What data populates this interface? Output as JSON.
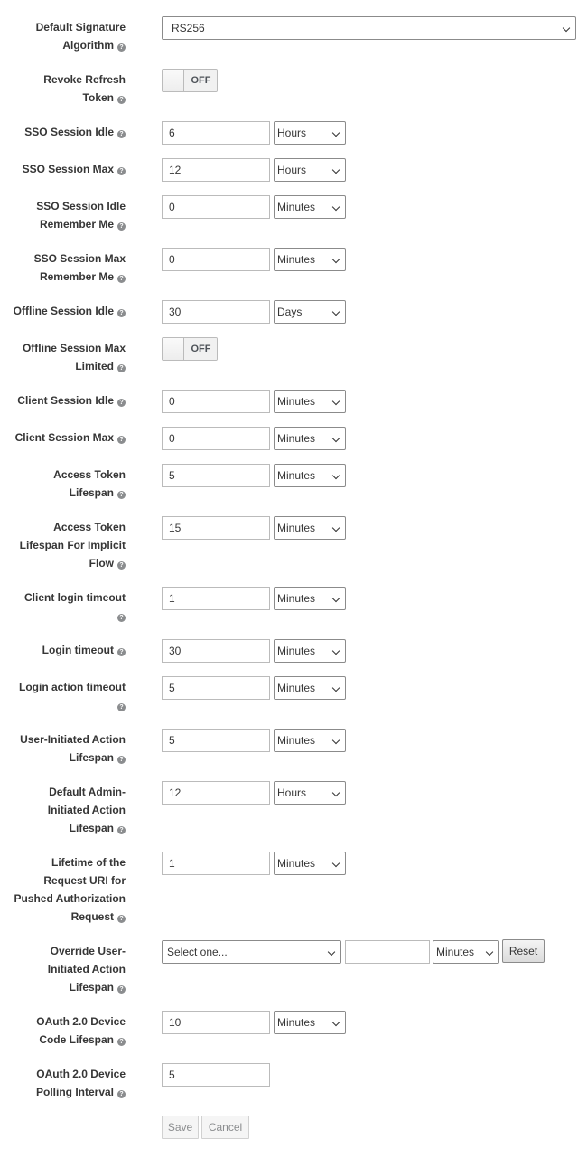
{
  "fields": {
    "default_signature_algorithm": {
      "label": [
        "Default Signature",
        "Algorithm"
      ],
      "value": "RS256"
    },
    "revoke_refresh_token": {
      "label": [
        "Revoke Refresh",
        "Token"
      ],
      "state": "OFF"
    },
    "sso_session_idle": {
      "label": [
        "SSO Session Idle"
      ],
      "value": "6",
      "unit": "Hours"
    },
    "sso_session_max": {
      "label": [
        "SSO Session Max"
      ],
      "value": "12",
      "unit": "Hours"
    },
    "sso_session_idle_remember_me": {
      "label": [
        "SSO Session Idle",
        "Remember Me"
      ],
      "value": "0",
      "unit": "Minutes"
    },
    "sso_session_max_remember_me": {
      "label": [
        "SSO Session Max",
        "Remember Me"
      ],
      "value": "0",
      "unit": "Minutes"
    },
    "offline_session_idle": {
      "label": [
        "Offline Session Idle"
      ],
      "value": "30",
      "unit": "Days"
    },
    "offline_session_max_limited": {
      "label": [
        "Offline Session Max",
        "Limited"
      ],
      "state": "OFF"
    },
    "client_session_idle": {
      "label": [
        "Client Session Idle"
      ],
      "value": "0",
      "unit": "Minutes"
    },
    "client_session_max": {
      "label": [
        "Client Session Max"
      ],
      "value": "0",
      "unit": "Minutes"
    },
    "access_token_lifespan": {
      "label": [
        "Access Token",
        "Lifespan"
      ],
      "value": "5",
      "unit": "Minutes"
    },
    "access_token_lifespan_implicit": {
      "label": [
        "Access Token",
        "Lifespan For Implicit",
        "Flow"
      ],
      "value": "15",
      "unit": "Minutes"
    },
    "client_login_timeout": {
      "label": [
        "Client login timeout",
        ""
      ],
      "value": "1",
      "unit": "Minutes"
    },
    "login_timeout": {
      "label": [
        "Login timeout"
      ],
      "value": "30",
      "unit": "Minutes"
    },
    "login_action_timeout": {
      "label": [
        "Login action timeout",
        ""
      ],
      "value": "5",
      "unit": "Minutes"
    },
    "user_initiated_action_lifespan": {
      "label": [
        "User-Initiated Action",
        "Lifespan"
      ],
      "value": "5",
      "unit": "Minutes"
    },
    "default_admin_initiated_action_lifespan": {
      "label": [
        "Default Admin-",
        "Initiated Action",
        "Lifespan"
      ],
      "value": "12",
      "unit": "Hours"
    },
    "request_uri_lifetime": {
      "label": [
        "Lifetime of the",
        "Request URI for",
        "Pushed Authorization",
        "Request"
      ],
      "value": "1",
      "unit": "Minutes"
    },
    "override_user_initiated_action_lifespan": {
      "label": [
        "Override User-",
        "Initiated Action",
        "Lifespan"
      ],
      "select": "Select one...",
      "value": "",
      "unit": "Minutes",
      "reset": "Reset"
    },
    "oauth_device_code_lifespan": {
      "label": [
        "OAuth 2.0 Device",
        "Code Lifespan"
      ],
      "value": "10",
      "unit": "Minutes"
    },
    "oauth_device_polling_interval": {
      "label": [
        "OAuth 2.0 Device",
        "Polling Interval"
      ],
      "value": "5"
    }
  },
  "actions": {
    "save": "Save",
    "cancel": "Cancel"
  },
  "icons": {
    "help": "question-circle-icon",
    "dropdown": "chevron-down-icon"
  },
  "colors": {
    "text": "#363636",
    "border": "#bbbbbb",
    "disabled_text": "#8b8d8f"
  }
}
